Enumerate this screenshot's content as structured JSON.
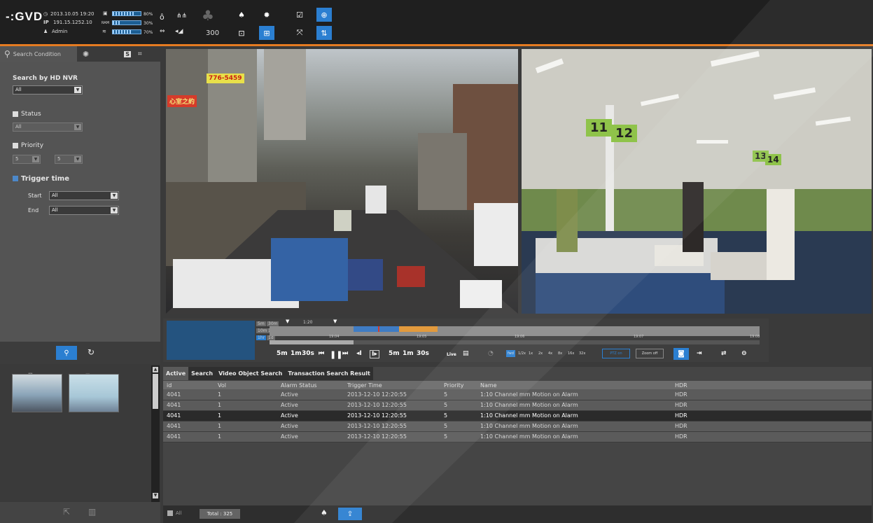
{
  "header": {
    "logo": "-:GVD",
    "datetime": "2013.10.05  19:20",
    "ip_label": "IP",
    "ip": "191.15.1252.10",
    "user": "Admin",
    "cpu_pct": "80%",
    "ram_label": "RAM",
    "ram_pct": "30%",
    "wifi_pct": "70%",
    "volume": "300",
    "cpu_level": 0.8,
    "ram_level": 0.3,
    "wifi_level": 0.7
  },
  "search": {
    "tab_label": "Search Condition",
    "hdnvr_label": "Search by HD NVR",
    "hdnvr_value": "All",
    "status_label": "Status",
    "status_value": "All",
    "priority_label": "Priority",
    "priority_from": "5",
    "priority_to": "5",
    "trigger_label": "Trigger time",
    "start_label": "Start",
    "start_value": "All",
    "end_label": "End",
    "end_value": "All",
    "badge": "S"
  },
  "cameras": {
    "street_sign1": "776-5459",
    "street_sign2": "心室之約",
    "store_sign1": "11",
    "store_sign2": "12",
    "store_sign3": "13",
    "store_sign4": "14"
  },
  "timeline": {
    "zoom_labels": [
      "5m",
      "30m",
      "10m",
      "12h",
      "1hr",
      "1d"
    ],
    "top_time": "1:20",
    "ticks": [
      "19:04",
      "19:05",
      "19:06",
      "19:07",
      "19:08"
    ],
    "controls": [
      "5m",
      "1m",
      "30s",
      "5m",
      "1m",
      "30s"
    ],
    "live_label": "Live",
    "speeds": [
      "fwd",
      "1/2x",
      "1x",
      "2x",
      "4x",
      "8x",
      "16x",
      "32x"
    ],
    "ptz_label": "PTZ on",
    "zoom_label": "Zoom off"
  },
  "results": {
    "tabs": [
      "Active",
      "Search",
      "Video Object Search",
      "Transaction Search Result"
    ],
    "columns": [
      "id",
      "Vol",
      "Alarm Status",
      "Trigger Time",
      "Priority",
      "Name",
      "HDR"
    ],
    "rows": [
      [
        "4041",
        "1",
        "Active",
        "2013-12-10 12:20:55",
        "5",
        "1:10 Channel mm Motion on Alarm",
        "HDR"
      ],
      [
        "4041",
        "1",
        "Active",
        "2013-12-10 12:20:55",
        "5",
        "1:10 Channel mm Motion on Alarm",
        "HDR"
      ],
      [
        "4041",
        "1",
        "Active",
        "2013-12-10 12:20:55",
        "5",
        "1:10 Channel mm Motion on Alarm",
        "HDR"
      ],
      [
        "4041",
        "1",
        "Active",
        "2013-12-10 12:20:55",
        "5",
        "1:10 Channel mm Motion on Alarm",
        "HDR"
      ],
      [
        "4041",
        "1",
        "Active",
        "2013-12-10 12:20:55",
        "5",
        "1:10 Channel mm Motion on Alarm",
        "HDR"
      ]
    ],
    "all_label": "All",
    "total": "Total : 325"
  }
}
